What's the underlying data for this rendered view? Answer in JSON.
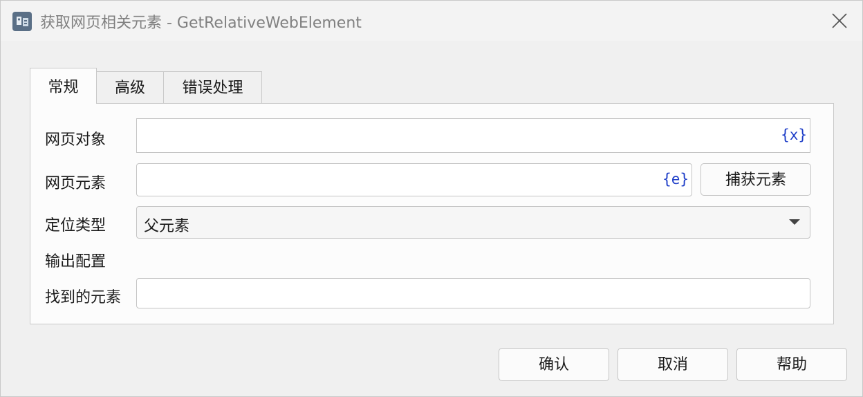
{
  "window": {
    "title": "获取网页相关元素 - GetRelativeWebElement"
  },
  "tabs": [
    {
      "label": "常规",
      "active": true
    },
    {
      "label": "高级",
      "active": false
    },
    {
      "label": "错误处理",
      "active": false
    }
  ],
  "form": {
    "web_object": {
      "label": "网页对象",
      "value": "",
      "var_button": "{x}"
    },
    "web_element": {
      "label": "网页元素",
      "value": "",
      "var_button": "{e}",
      "capture_label": "捕获元素"
    },
    "locate_type": {
      "label": "定位类型",
      "selected": "父元素"
    },
    "output_section_label": "输出配置",
    "found_element": {
      "label": "找到的元素",
      "value": ""
    }
  },
  "footer": {
    "confirm_label": "确认",
    "cancel_label": "取消",
    "help_label": "帮助"
  },
  "colors": {
    "var_button": "#1e3ec8",
    "title_text": "#808080"
  }
}
